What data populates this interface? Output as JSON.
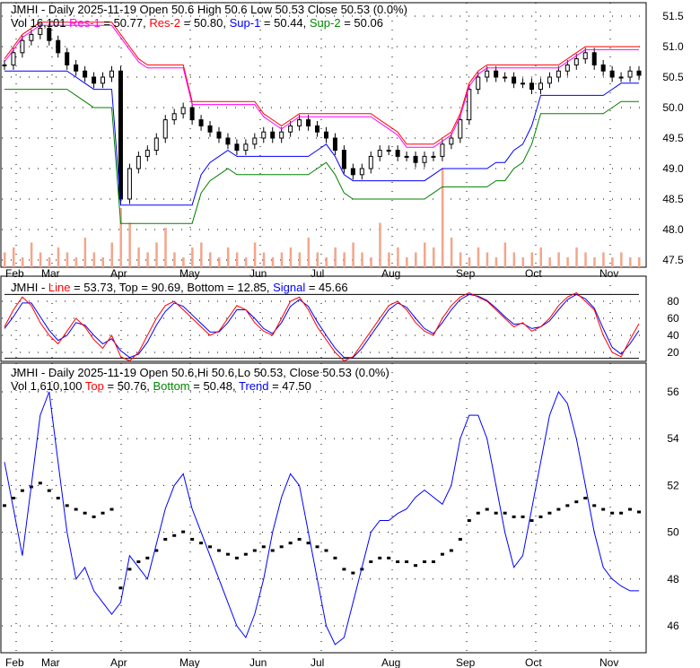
{
  "panel1": {
    "line1": "JMHI - Daily 2025-11-19 Open 50.6  High 50.6  Low 50.53  Close 50.53 (0.0%)",
    "vol": "Vol 16,101",
    "res1_label": "Res-1",
    "res1_val": " = 50.77, ",
    "res2_label": "Res-2",
    "res2_val": " = 50.80, ",
    "sup1_label": "Sup-1",
    "sup1_val": " = 50.44, ",
    "sup2_label": "Sup-2",
    "sup2_val": " = 50.06"
  },
  "panel2": {
    "prefix": "JMHI - ",
    "line_label": "Line",
    "line_val": " = 53.73, Top = 90.69, Bottom = 12.85, ",
    "signal_label": "Signal",
    "signal_val": " = 45.66"
  },
  "panel3": {
    "line1": "JMHI - Daily 2025-11-19 Open 50.6,Hi 50.6,Lo 50.53, Close 50.53 (0.0%)",
    "vol": "Vol 1,610,100 ",
    "top_label": "Top",
    "top_val": " = 50.76, ",
    "bottom_label": "Bottom",
    "bottom_val": " = 50.48, ",
    "trend_label": "Trend",
    "trend_val": " = 47.50"
  },
  "colors": {
    "res1": "#ff00ff",
    "res2": "#ff0000",
    "sup1": "#0000ff",
    "sup2": "#008000",
    "vol": "#f4a58a"
  },
  "chart_data": [
    {
      "type": "candlestick",
      "title": "JMHI - Daily",
      "x_ticks": [
        "Feb",
        "Mar",
        "Apr",
        "May",
        "Jun",
        "Jul",
        "Aug",
        "Sep",
        "Oct",
        "Nov"
      ],
      "y_ticks": [
        51.5,
        51.0,
        50.5,
        50.0,
        49.5,
        49.0,
        48.5,
        48.0,
        47.5
      ],
      "ylim": [
        47.4,
        51.7
      ],
      "close": [
        50.7,
        50.9,
        51.1,
        51.2,
        51.3,
        51.1,
        50.9,
        50.7,
        50.6,
        50.5,
        50.4,
        50.5,
        50.6,
        48.5,
        49.0,
        49.2,
        49.3,
        49.5,
        49.8,
        49.9,
        50.0,
        49.8,
        49.7,
        49.6,
        49.5,
        49.4,
        49.3,
        49.4,
        49.5,
        49.6,
        49.5,
        49.6,
        49.7,
        49.8,
        49.7,
        49.6,
        49.5,
        49.3,
        49.0,
        48.9,
        49.0,
        49.2,
        49.3,
        49.3,
        49.2,
        49.2,
        49.1,
        49.2,
        49.2,
        49.4,
        49.5,
        49.8,
        50.3,
        50.5,
        50.6,
        50.5,
        50.5,
        50.4,
        50.4,
        50.3,
        50.4,
        50.5,
        50.6,
        50.7,
        50.8,
        50.9,
        50.7,
        50.6,
        50.5,
        50.5,
        50.6,
        50.53
      ],
      "volume": [
        3,
        4,
        2,
        5,
        3,
        2,
        4,
        3,
        2,
        6,
        3,
        2,
        5,
        12,
        9,
        4,
        3,
        5,
        8,
        3,
        2,
        4,
        5,
        3,
        2,
        4,
        3,
        2,
        5,
        3,
        2,
        3,
        4,
        3,
        6,
        3,
        2,
        4,
        3,
        5,
        3,
        2,
        9,
        3,
        4,
        2,
        3,
        5,
        4,
        20,
        6,
        3,
        2,
        4,
        3,
        2,
        5,
        3,
        2,
        3,
        4,
        2,
        3,
        2,
        4,
        3,
        2,
        3,
        2,
        3,
        2,
        2
      ]
    },
    {
      "type": "line",
      "title": "Stochastic",
      "y_ticks": [
        80,
        60,
        40,
        20
      ],
      "ylim": [
        0,
        100
      ],
      "line": [
        50,
        70,
        85,
        75,
        55,
        40,
        30,
        45,
        60,
        50,
        35,
        25,
        40,
        15,
        10,
        20,
        40,
        60,
        75,
        80,
        70,
        60,
        50,
        40,
        45,
        60,
        75,
        70,
        55,
        45,
        40,
        60,
        80,
        85,
        70,
        50,
        35,
        20,
        10,
        15,
        30,
        45,
        60,
        75,
        80,
        70,
        55,
        45,
        40,
        60,
        75,
        85,
        90,
        85,
        80,
        70,
        60,
        50,
        55,
        45,
        50,
        60,
        75,
        85,
        90,
        80,
        70,
        40,
        20,
        15,
        35,
        53.73
      ],
      "signal": [
        48,
        62,
        78,
        78,
        62,
        46,
        34,
        40,
        55,
        52,
        40,
        30,
        36,
        22,
        14,
        18,
        32,
        52,
        68,
        78,
        74,
        64,
        54,
        44,
        44,
        55,
        70,
        70,
        60,
        48,
        42,
        55,
        74,
        82,
        74,
        56,
        40,
        25,
        14,
        14,
        25,
        40,
        55,
        70,
        78,
        73,
        60,
        48,
        42,
        55,
        70,
        82,
        88,
        86,
        81,
        72,
        62,
        53,
        54,
        48,
        50,
        57,
        70,
        82,
        88,
        83,
        72,
        48,
        26,
        18,
        30,
        45.66
      ]
    },
    {
      "type": "line",
      "title": "Trend",
      "y_ticks": [
        56,
        54,
        52,
        50,
        48,
        46
      ],
      "ylim": [
        45,
        56.6
      ],
      "trend": [
        53,
        51,
        49,
        52,
        55,
        56,
        53,
        50,
        48,
        48.5,
        47.5,
        47,
        46.5,
        47,
        49,
        48.5,
        48,
        49.5,
        51,
        52,
        52.5,
        51,
        50,
        49,
        48,
        47,
        46,
        45.5,
        46.5,
        48,
        50,
        51.5,
        52.5,
        52,
        50,
        48,
        46,
        45.2,
        45.5,
        47,
        48.5,
        50,
        50.5,
        50.5,
        50.8,
        51,
        51.5,
        51.8,
        51.5,
        51.2,
        52,
        54,
        55,
        55,
        54,
        52,
        50,
        48.5,
        49,
        51,
        53,
        55,
        56,
        55.5,
        54,
        52,
        50,
        48.5,
        48,
        47.7,
        47.5,
        47.5
      ]
    }
  ]
}
